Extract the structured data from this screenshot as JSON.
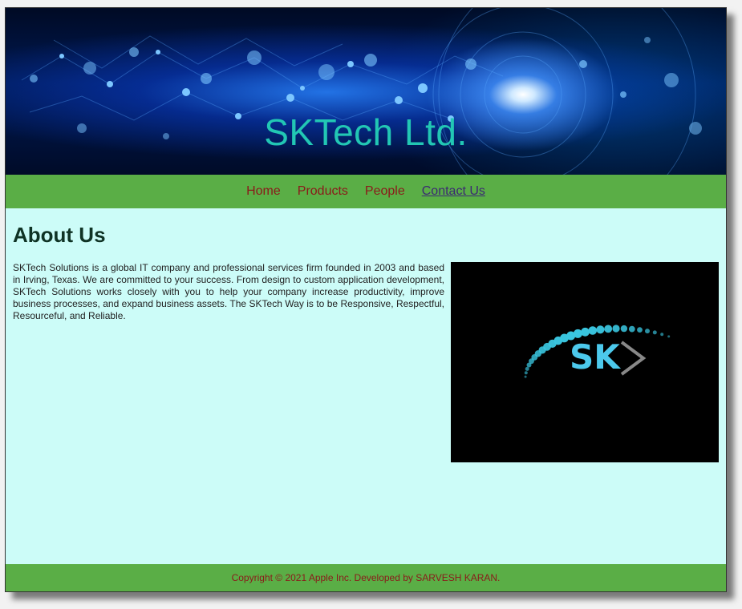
{
  "header": {
    "title": "SKTech Ltd."
  },
  "nav": {
    "items": [
      {
        "label": "Home"
      },
      {
        "label": "Products"
      },
      {
        "label": "People"
      },
      {
        "label": "Contact Us",
        "active": true
      }
    ]
  },
  "main": {
    "heading": "About Us",
    "paragraph": "SKTech Solutions is a global IT company and professional services firm founded in 2003 and based in Irving, Texas. We are committed to your success. From design to custom application development, SKTech Solutions works closely with you to help your company increase productivity, improve business processes, and expand business assets. The SKTech Way is to be Responsive, Respectful, Resourceful, and Reliable.",
    "logo_text": "SK"
  },
  "footer": {
    "text": "Copyright © 2021 Apple Inc. Developed by SARVESH KARAN."
  },
  "colors": {
    "nav_bg": "#5aae46",
    "content_bg": "#ccfcf8",
    "title_color": "#22c7b4",
    "link_color": "#8b1a1a",
    "active_link_color": "#3b2a73"
  }
}
